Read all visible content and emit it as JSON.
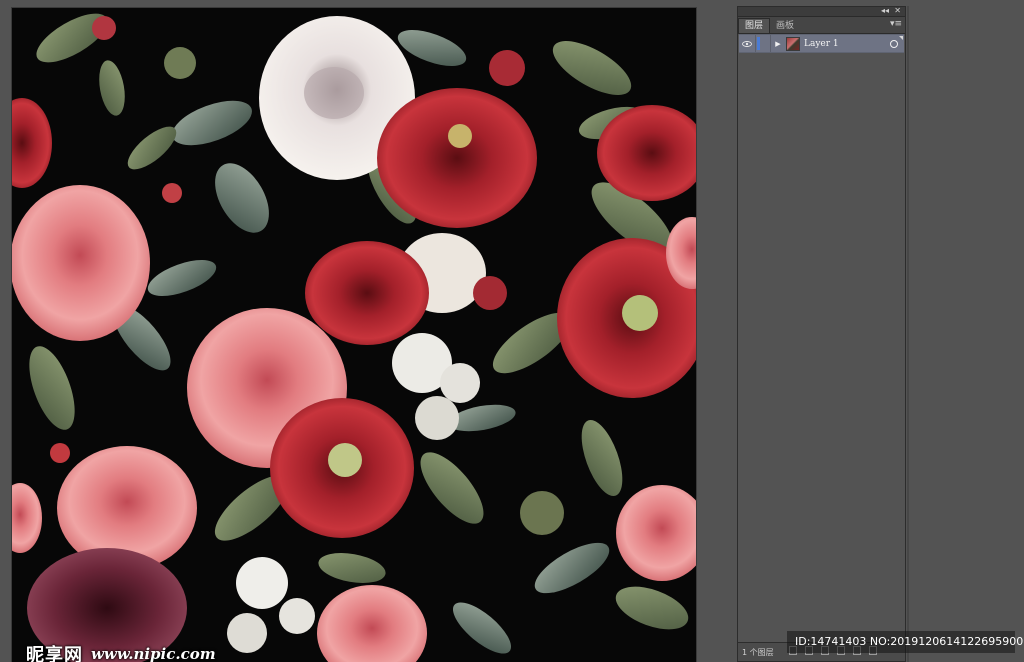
{
  "panel": {
    "collapse_glyph": "◂◂",
    "close_glyph": "✕",
    "tabs": [
      {
        "label": "图层",
        "active": true
      },
      {
        "label": "画板",
        "active": false
      }
    ],
    "menu_glyph": "▾≡",
    "layers": [
      {
        "name": "Layer 1",
        "visible": true,
        "expanded": false,
        "selected": true
      }
    ],
    "footer": {
      "layer_count": "1 个图层"
    }
  },
  "watermark": {
    "logo": "昵享网",
    "url": "www.nipic.com"
  },
  "id_overlay": "ID:14741403 NO:20191206141226959000",
  "colors": {
    "workspace": "#535353",
    "layer_selected": "#6e7384",
    "layer_color_bar": "#4a7bd4",
    "artboard_bg": "#070707"
  }
}
